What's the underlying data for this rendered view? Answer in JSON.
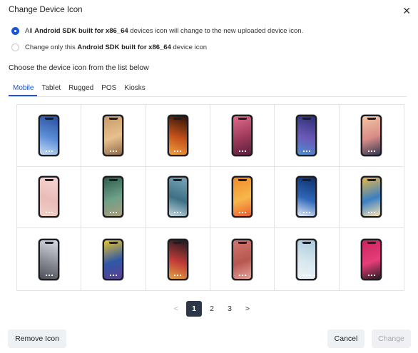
{
  "dialog": {
    "title": "Change Device Icon",
    "close_icon": "✕"
  },
  "options": [
    {
      "pre": "All ",
      "bold": "Android SDK built for x86_64",
      "post": " devices icon will change to the new uploaded device icon.",
      "checked": true
    },
    {
      "pre": "Change only this ",
      "bold": "Android SDK built for x86_64",
      "post": " device icon",
      "checked": false
    }
  ],
  "choose_label": "Choose the device icon from the list below",
  "tabs": [
    {
      "label": "Mobile",
      "active": true
    },
    {
      "label": "Tablet",
      "active": false
    },
    {
      "label": "Rugged",
      "active": false
    },
    {
      "label": "POS",
      "active": false
    },
    {
      "label": "Kiosks",
      "active": false
    }
  ],
  "device_icons": [
    {
      "wallpaper": "blue-gradient",
      "colors": [
        "#274c9c",
        "#5c8fd8",
        "#c9ddf2"
      ]
    },
    {
      "wallpaper": "hot-air-balloon",
      "colors": [
        "#c79a6a",
        "#e7c08d",
        "#8e6a4a"
      ]
    },
    {
      "wallpaper": "orange-curves",
      "colors": [
        "#2a1308",
        "#c5521b",
        "#f0a040"
      ]
    },
    {
      "wallpaper": "pink-sunset",
      "colors": [
        "#e06a8a",
        "#9d3a5b",
        "#5d1e3b"
      ]
    },
    {
      "wallpaper": "blue-geometric",
      "colors": [
        "#2a2f73",
        "#6a59b8",
        "#4d8fd1"
      ]
    },
    {
      "wallpaper": "mountain-dusk",
      "colors": [
        "#f3c5a4",
        "#d98c88",
        "#32394f"
      ]
    },
    {
      "wallpaper": "pink-pastel",
      "colors": [
        "#f6d6d3",
        "#e9bcb8",
        "#f1cfc9"
      ]
    },
    {
      "wallpaper": "green-coast",
      "colors": [
        "#2c5e4d",
        "#6fa089",
        "#a99c7a"
      ]
    },
    {
      "wallpaper": "ocean-aerial",
      "colors": [
        "#7aa6b8",
        "#3d6f86",
        "#c2d9e0"
      ]
    },
    {
      "wallpaper": "orange-fluid",
      "colors": [
        "#f28a2a",
        "#f7b84b",
        "#ed5d2f"
      ]
    },
    {
      "wallpaper": "waterfall-blue",
      "colors": [
        "#0d2e6c",
        "#2f68b9",
        "#e5f0f8"
      ]
    },
    {
      "wallpaper": "yellow-blue-wave",
      "colors": [
        "#e7b84a",
        "#3b7fc4",
        "#f6e3b0"
      ]
    },
    {
      "wallpaper": "building-sky",
      "colors": [
        "#d8dee6",
        "#8a8d94",
        "#4c4f55"
      ]
    },
    {
      "wallpaper": "yellow-abstract",
      "colors": [
        "#e8c32e",
        "#2f58a8",
        "#5d3e8f"
      ]
    },
    {
      "wallpaper": "light-trails",
      "colors": [
        "#1b1a20",
        "#c23b36",
        "#e3a342"
      ]
    },
    {
      "wallpaper": "coral-interior",
      "colors": [
        "#d2766f",
        "#b8574f",
        "#e5a39c"
      ]
    },
    {
      "wallpaper": "white-stool",
      "colors": [
        "#a9c8d9",
        "#d8e7ef",
        "#edf3f6"
      ]
    },
    {
      "wallpaper": "magenta-figure",
      "colors": [
        "#c8245e",
        "#e53e79",
        "#2a1c24"
      ]
    }
  ],
  "pagination": {
    "prev": "<",
    "pages": [
      "1",
      "2",
      "3"
    ],
    "active_page": "1",
    "next": ">"
  },
  "buttons": {
    "remove": "Remove Icon",
    "cancel": "Cancel",
    "change": "Change"
  }
}
